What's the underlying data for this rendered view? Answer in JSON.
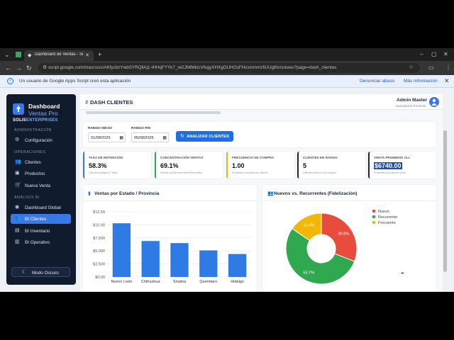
{
  "browser": {
    "tab_title": "Dashboard de Ventas - Sistem",
    "url": "script.google.com/macros/s/AKfycbzYwbSYRQllAj1-tHHqFYYk7_wi2JMlMkicVfxgyXHXgOUHOsFHcsmmmzfiUUg8Ivrs/exec?page=dash_clientes",
    "banner_text": "Un usuario de Google Apps Script creó esta aplicación",
    "banner_report": "Denunciar abuso",
    "banner_more": "Más información"
  },
  "sidebar": {
    "logo_line1": "Dashboard",
    "logo_line2": "Ventas Pro",
    "brand_a": "SOLIS",
    "brand_b": "ENTERPRISES",
    "sections": {
      "admin": "ADMINISTRACIÓN",
      "ops": "OPERACIONES",
      "bi": "ANÁLISIS BI"
    },
    "items": [
      {
        "label": "Configuración",
        "icon": "gear-icon"
      },
      {
        "label": "Clientes",
        "icon": "users-icon"
      },
      {
        "label": "Productos",
        "icon": "box-icon"
      },
      {
        "label": "Nueva Venta",
        "icon": "cart-icon"
      },
      {
        "label": "Dashboard Global",
        "icon": "globe-icon"
      },
      {
        "label": "BI Clientes",
        "icon": "users-icon"
      },
      {
        "label": "BI Inventario",
        "icon": "boxes-icon"
      },
      {
        "label": "BI Operativo",
        "icon": "chart-icon"
      }
    ],
    "dark_mode": "Modo Oscuro"
  },
  "header": {
    "title": "DASH CLIENTES",
    "user_name": "Admin Master",
    "user_sub": "Suscripción Premium"
  },
  "filters": {
    "start_label": "RANGO INICIO",
    "start_value": "01/08/2026",
    "end_label": "RANGO FIN",
    "end_value": "05/08/2026",
    "analyze": "ANALIZAR CLIENTES"
  },
  "kpis": [
    {
      "label": "TASA DE RETENCIÓN",
      "value": "58.3%",
      "sub": "Clientes antiguos / Total",
      "color": "#3a78e8"
    },
    {
      "label": "CONCENTRACIÓN VENTAS",
      "value": "69.1%",
      "sub": "Ventas de Recurrentes/Frecuentes",
      "color": "#2fa84f"
    },
    {
      "label": "FRECUENCIA DE COMPRA",
      "value": "1.00",
      "sub": "Promedio compras por cliente",
      "color": "#f2b705"
    },
    {
      "label": "CLIENTES EN RANGO",
      "value": "5",
      "sub": "Clientes únicos con compra",
      "color": "#1d2738"
    },
    {
      "label": "VENTA PROMEDIO CLI.",
      "value": "$6740.00",
      "sub": "Promedio por cliente único",
      "color": "#1d2738"
    }
  ],
  "bar_card_title": "Ventas por Estado / Provincia",
  "pie_card_title": "Nuevos vs. Recurrentes (Fidelización)",
  "chart_data": [
    {
      "type": "bar",
      "title": "Ventas por Estado / Provincia",
      "categories": [
        "Nuevo León",
        "Chihuahua",
        "Sinaloa",
        "Querétaro",
        "Hidalgo"
      ],
      "values": [
        10300,
        6900,
        6500,
        5100,
        4400
      ],
      "ylim": [
        0,
        12500
      ],
      "yticks": [
        "$0.00",
        "$2,500",
        "$5,000",
        "$7,500",
        "$10,00",
        "$12,50"
      ],
      "ytick_values": [
        0,
        2500,
        5000,
        7500,
        10000,
        12500
      ],
      "color": "#2f7be6",
      "grid": true
    },
    {
      "type": "pie",
      "title": "Nuevos vs. Recurrentes (Fidelización)",
      "donut": true,
      "labels": [
        "Nuevo",
        "Recurrente",
        "Frecuente"
      ],
      "values": [
        30.8,
        53.7,
        15.4
      ],
      "value_labels": [
        "30.8%",
        "53.7%",
        "15.4%"
      ],
      "colors": [
        "#e74c3c",
        "#2fa84f",
        "#f2b705"
      ],
      "legend": "top-right"
    }
  ]
}
